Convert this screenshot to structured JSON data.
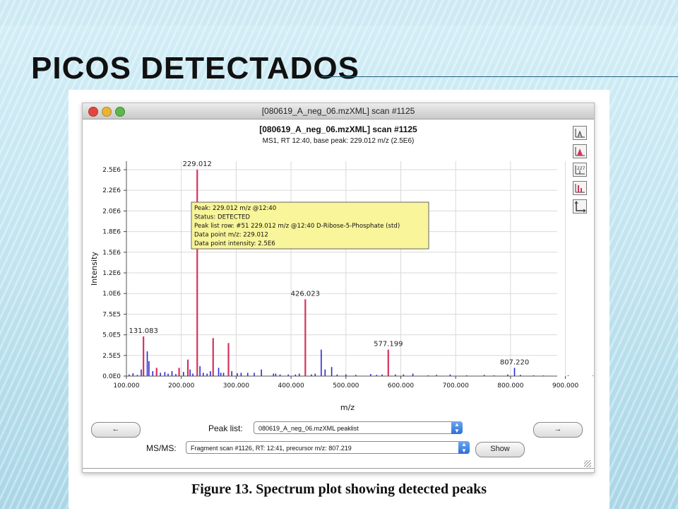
{
  "slide": {
    "title": "PICOS DETECTADOS",
    "caption": "Figure 13. Spectrum plot showing detected peaks"
  },
  "window": {
    "title": "[080619_A_neg_06.mzXML] scan #1125"
  },
  "toolbar_icons": [
    "peak-shape-icon",
    "detected-peaks-icon",
    "annotation-icon",
    "isotope-icon",
    "axes-icon"
  ],
  "controls": {
    "prev_label": "←",
    "next_label": "→",
    "peak_list_label": "Peak list:",
    "peak_list_value": "080619_A_neg_06.mzXML peaklist",
    "msms_label": "MS/MS:",
    "msms_value": "Fragment scan #1126, RT: 12:41, precursor m/z: 807.219",
    "show_label": "Show"
  },
  "tooltip": {
    "lines": [
      "Peak: 229.012 m/z @12:40",
      "Status: DETECTED",
      "Peak list row: #51 229.012 m/z @12:40 D-Ribose-5-Phosphate (std)",
      "Data point m/z: 229.012",
      "Data point intensity: 2.5E6"
    ]
  },
  "colors": {
    "detected": "#d8315b",
    "raw": "#2a2ad0",
    "tooltip_bg": "#f8f59a",
    "grid": "#d9d9d9"
  },
  "chart_data": {
    "type": "bar",
    "title": "[080619_A_neg_06.mzXML] scan #1125",
    "subtitle": "MS1, RT 12:40, base peak: 229.012 m/z (2.5E6)",
    "xlabel": "m/z",
    "ylabel": "Intensity",
    "xlim": [
      100,
      1000
    ],
    "ylim": [
      0,
      2500000
    ],
    "x_ticks": [
      "100.000",
      "200.000",
      "300.000",
      "400.000",
      "500.000",
      "600.000",
      "700.000",
      "800.000",
      "900.000"
    ],
    "y_ticks": [
      "0.0E0",
      "2.5E5",
      "5.0E5",
      "7.5E5",
      "1.0E6",
      "1.2E6",
      "1.5E6",
      "1.8E6",
      "2.0E6",
      "2.2E6",
      "2.5E6"
    ],
    "grid": true,
    "series": [
      {
        "name": "Detected peaks",
        "x": [
          131.083,
          155,
          196,
          212,
          229.012,
          258,
          286,
          426.023,
          577.199
        ],
        "values": [
          480000,
          100000,
          100000,
          200000,
          2500000,
          460000,
          400000,
          930000,
          320000
        ]
      },
      {
        "name": "Raw spectrum",
        "x": [
          105,
          112,
          120,
          127,
          138,
          141,
          148,
          155,
          162,
          170,
          176,
          183,
          190,
          204,
          216,
          221,
          234,
          240,
          247,
          253,
          268,
          272,
          277,
          292,
          302,
          309,
          321,
          333,
          346,
          368,
          372,
          380,
          395,
          408,
          415,
          437,
          444,
          455,
          462,
          474,
          484,
          500,
          518,
          545,
          556,
          566,
          590,
          605,
          622,
          650,
          665,
          690,
          720,
          752,
          770,
          795,
          807.22,
          818,
          842,
          860,
          905,
          950
        ],
        "values": [
          20000,
          35000,
          15000,
          80000,
          300000,
          180000,
          60000,
          90000,
          40000,
          50000,
          30000,
          60000,
          25000,
          50000,
          80000,
          30000,
          120000,
          40000,
          30000,
          60000,
          100000,
          40000,
          40000,
          60000,
          35000,
          40000,
          40000,
          40000,
          80000,
          30000,
          30000,
          20000,
          20000,
          20000,
          30000,
          20000,
          30000,
          320000,
          80000,
          110000,
          20000,
          20000,
          15000,
          25000,
          15000,
          20000,
          20000,
          20000,
          30000,
          10000,
          15000,
          20000,
          10000,
          15000,
          10000,
          20000,
          100000,
          15000,
          10000,
          8000,
          8000,
          5000
        ]
      }
    ],
    "annotations": [
      {
        "x": 229.012,
        "value": 2500000,
        "text": "229.012"
      },
      {
        "x": 131.083,
        "value": 480000,
        "text": "131.083"
      },
      {
        "x": 426.023,
        "value": 930000,
        "text": "426.023"
      },
      {
        "x": 577.199,
        "value": 320000,
        "text": "577.199"
      },
      {
        "x": 807.22,
        "value": 100000,
        "text": "807.220"
      }
    ]
  }
}
